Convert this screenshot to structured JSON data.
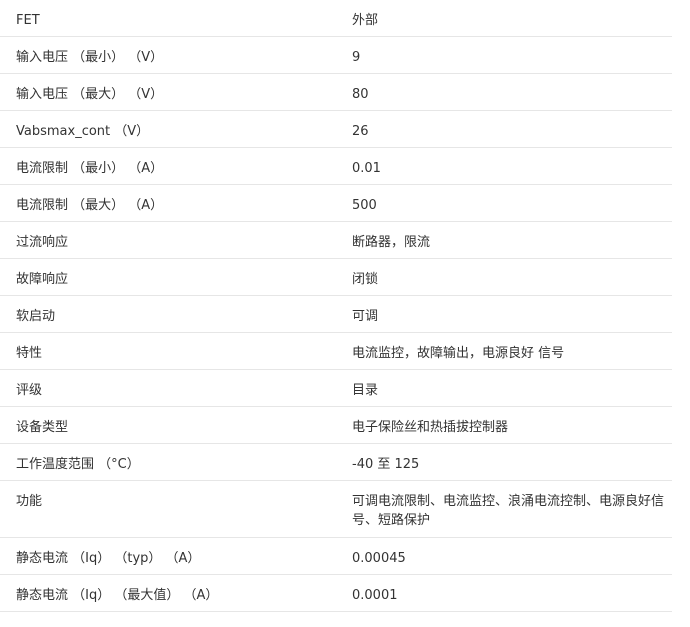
{
  "rows": [
    {
      "label": "FET",
      "value": "外部"
    },
    {
      "label": "输入电压 （最小） （V）",
      "value": "9"
    },
    {
      "label": "输入电压 （最大） （V）",
      "value": "80"
    },
    {
      "label": "Vabsmax_cont （V）",
      "value": "26"
    },
    {
      "label": "电流限制 （最小） （A）",
      "value": "0.01"
    },
    {
      "label": "电流限制 （最大） （A）",
      "value": "500"
    },
    {
      "label": "过流响应",
      "value": "断路器，限流"
    },
    {
      "label": "故障响应",
      "value": "闭锁"
    },
    {
      "label": "软启动",
      "value": "可调"
    },
    {
      "label": "特性",
      "value": "电流监控，故障输出，电源良好 信号"
    },
    {
      "label": "评级",
      "value": "目录"
    },
    {
      "label": "设备类型",
      "value": "电子保险丝和热插拔控制器"
    },
    {
      "label": "工作温度范围 （°C）",
      "value": "-40 至 125"
    },
    {
      "label": "功能",
      "value": "可调电流限制、电流监控、浪涌电流控制、电源良好信号、短路保护"
    },
    {
      "label": "静态电流 （Iq） （typ） （A）",
      "value": "0.00045"
    },
    {
      "label": "静态电流 （Iq） （最大值） （A）",
      "value": "0.0001"
    }
  ]
}
